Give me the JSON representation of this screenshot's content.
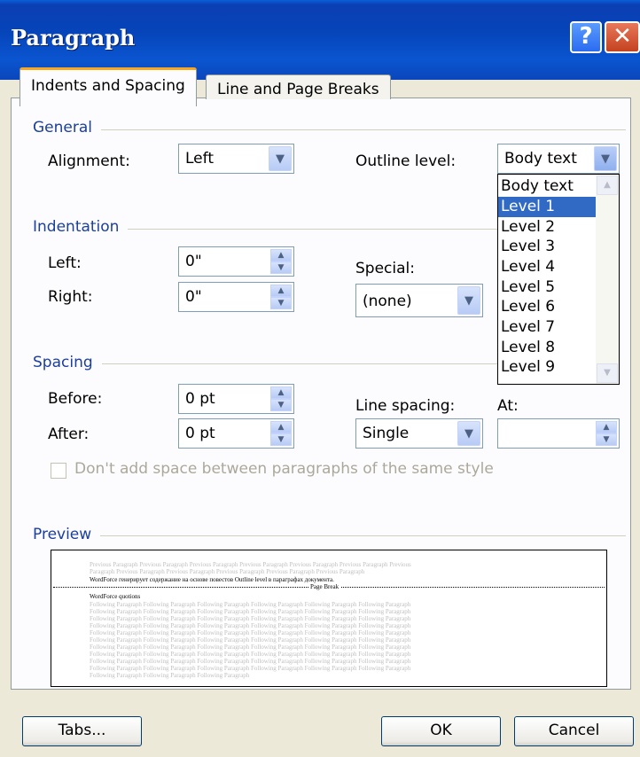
{
  "window": {
    "title": "Paragraph",
    "help_glyph": "?",
    "close_glyph": "✕"
  },
  "tabs": [
    {
      "label": "Indents and Spacing",
      "active": true
    },
    {
      "label": "Line and Page Breaks",
      "active": false
    }
  ],
  "general": {
    "heading": "General",
    "alignment_label": "Alignment:",
    "alignment_value": "Left",
    "outline_label": "Outline level:",
    "outline_value": "Body text",
    "outline_options": [
      "Body text",
      "Level 1",
      "Level 2",
      "Level 3",
      "Level 4",
      "Level 5",
      "Level 6",
      "Level 7",
      "Level 8",
      "Level 9"
    ],
    "outline_highlighted": "Level 1"
  },
  "indentation": {
    "heading": "Indentation",
    "left_label": "Left:",
    "left_value": "0\"",
    "right_label": "Right:",
    "right_value": "0\"",
    "special_label": "Special:",
    "special_value": "(none)"
  },
  "spacing": {
    "heading": "Spacing",
    "before_label": "Before:",
    "before_value": "0 pt",
    "after_label": "After:",
    "after_value": "0 pt",
    "line_spacing_label": "Line spacing:",
    "line_spacing_value": "Single",
    "at_label": "At:",
    "at_value": "",
    "no_space_label": "Don't add space between paragraphs of the same style",
    "no_space_checked": false
  },
  "preview": {
    "heading": "Preview",
    "prev_lines": [
      "Previous Paragraph Previous Paragraph Previous Paragraph Previous Paragraph Previous Paragraph Previous Paragraph Previous",
      "Paragraph Previous Paragraph Previous Paragraph Previous Paragraph Previous Paragraph Previous Paragraph"
    ],
    "current_line": "WordForce генерирует содержание на основе повестов Outline level в параграфах документа.",
    "page_break": "Page Break",
    "next_first": "WordForce quotions",
    "next_line": "Following Paragraph Following Paragraph Following Paragraph Following Paragraph Following Paragraph Following Paragraph",
    "last_line": "Following Paragraph Following Paragraph Following Paragraph"
  },
  "buttons": {
    "tabs": "Tabs...",
    "ok": "OK",
    "cancel": "Cancel"
  },
  "colors": {
    "title_bar": "#0a55d0",
    "group_heading": "#1b3f9c",
    "selection": "#316ac5",
    "tab_accent": "#f5a623"
  }
}
